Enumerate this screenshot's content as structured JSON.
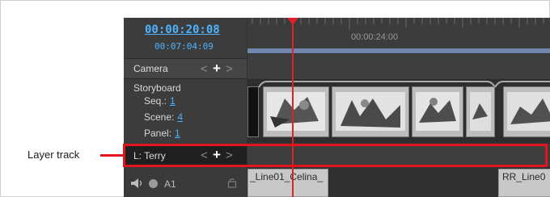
{
  "timecode": {
    "current": "00:00:20:08",
    "total": "00:07:04:09"
  },
  "ruler": {
    "marker": "00:00:24:00"
  },
  "tracks": {
    "camera": {
      "label": "Camera"
    },
    "storyboard": {
      "title": "Storyboard",
      "seq_label": "Seq.:",
      "seq_value": "1",
      "scene_label": "Scene:",
      "scene_value": "4",
      "panel_label": "Panel:",
      "panel_value": "1"
    },
    "layer": {
      "label": "L: Terry"
    },
    "audio": {
      "label": "A1"
    }
  },
  "controls": {
    "prev": "<",
    "add": "+",
    "next": ">"
  },
  "audio_clips": [
    "_Line01_Celina_",
    "RR_Line0"
  ],
  "annotation": {
    "label": "Layer track"
  },
  "colors": {
    "accent": "#4db3ff",
    "playhead": "#e0202a",
    "highlight": "#e2141f"
  }
}
